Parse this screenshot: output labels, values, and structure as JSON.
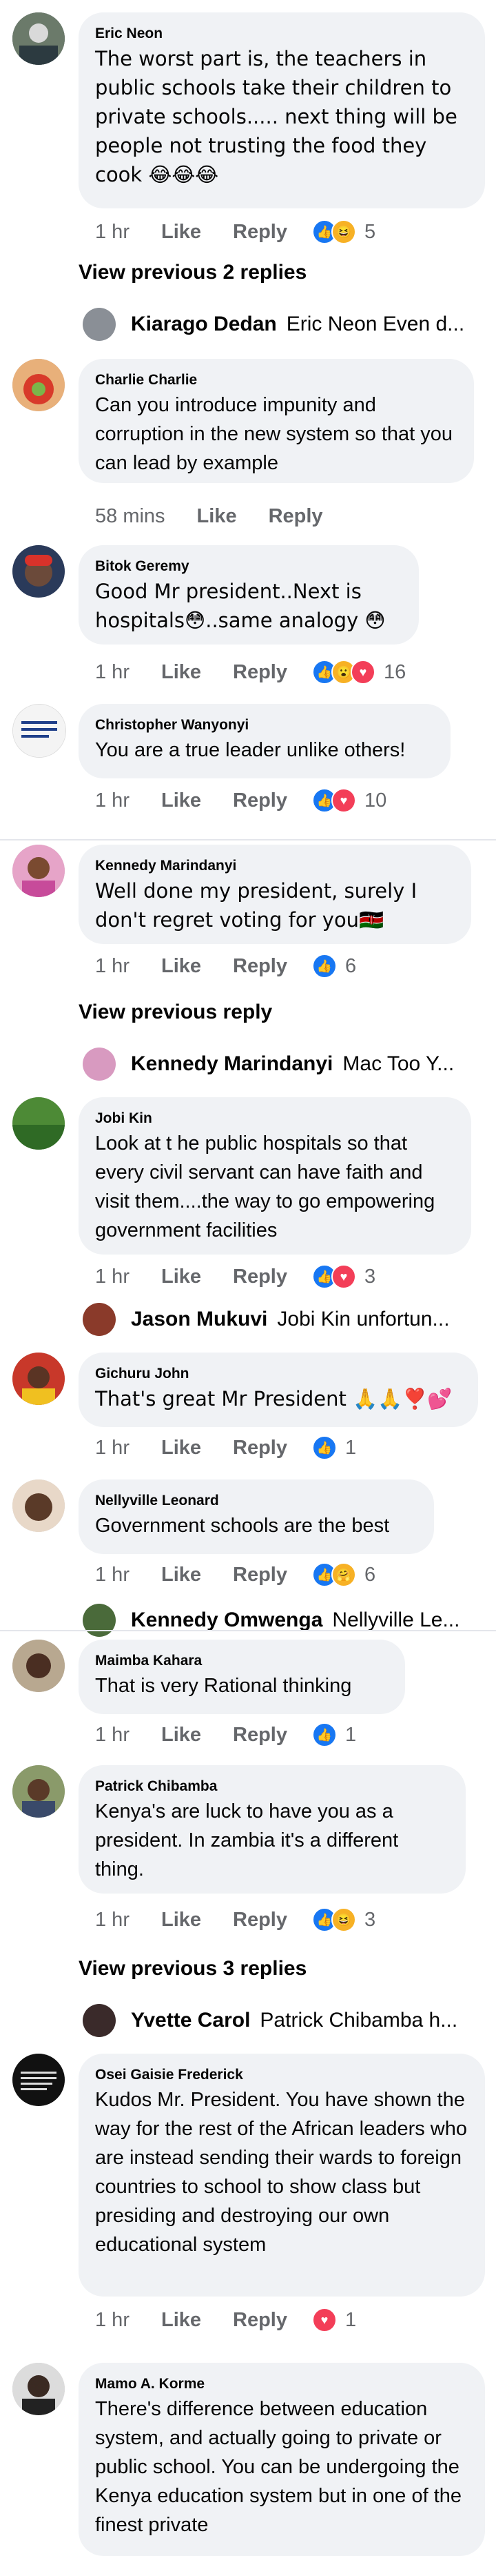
{
  "comments": [
    {
      "author": "Eric Neon",
      "text": "The worst part is, the teachers in public schools take their children to private schools..... next thing will be people not trusting the food they cook 😂😂😂",
      "time": "1 hr",
      "like": "Like",
      "reply": "Reply",
      "count": "5"
    },
    {
      "author": "Charlie Charlie",
      "text": "Can you introduce impunity and corruption in the new system so that you can lead by example",
      "time": "58 mins",
      "like": "Like",
      "reply": "Reply",
      "count": ""
    },
    {
      "author": "Bitok Geremy",
      "text": "Good Mr president..Next is hospitals😳..same analogy 😳",
      "time": "1 hr",
      "like": "Like",
      "reply": "Reply",
      "count": "16"
    },
    {
      "author": "Christopher Wanyonyi",
      "text": "You are a true leader unlike others!",
      "time": "1 hr",
      "like": "Like",
      "reply": "Reply",
      "count": "10"
    },
    {
      "author": "Kennedy Marindanyi",
      "text": "Well done my president, surely I don't regret voting for you🇰🇪",
      "time": "1 hr",
      "like": "Like",
      "reply": "Reply",
      "count": "6"
    },
    {
      "author": "Jobi Kin",
      "text": "Look at t he public hospitals so that every civil servant can have faith and visit them....the way to go empowering government facilities",
      "time": "1 hr",
      "like": "Like",
      "reply": "Reply",
      "count": "3"
    },
    {
      "author": "Gichuru John",
      "text": "That's great Mr President 🙏🙏❣️💕",
      "time": "1 hr",
      "like": "Like",
      "reply": "Reply",
      "count": "1"
    },
    {
      "author": "Nellyville Leonard",
      "text": "Government schools are the best",
      "time": "1 hr",
      "like": "Like",
      "reply": "Reply",
      "count": "6"
    },
    {
      "author": "Maimba Kahara",
      "text": "That is very Rational thinking",
      "time": "1 hr",
      "like": "Like",
      "reply": "Reply",
      "count": "1"
    },
    {
      "author": "Patrick Chibamba",
      "text": "Kenya's are luck to have you as a president. In zambia it's a different thing.",
      "time": "1 hr",
      "like": "Like",
      "reply": "Reply",
      "count": "3"
    },
    {
      "author": "Osei Gaisie Frederick",
      "text": "Kudos Mr. President.  You have shown the way for the rest of the African leaders who are instead sending their wards to foreign countries to school to show class but presiding and destroying our own educational system",
      "time": "1 hr",
      "like": "Like",
      "reply": "Reply",
      "count": "1"
    },
    {
      "author": "Mamo A. Korme",
      "text": "There's difference between education system, and actually going to private or public school. You can be undergoing the Kenya education system but in one of the finest private",
      "time": "",
      "like": "",
      "reply": "",
      "count": ""
    }
  ],
  "view_previous": {
    "two": "View previous 2 replies",
    "one": "View previous reply",
    "three": "View previous 3 replies"
  },
  "replies": [
    {
      "name": "Kiarago Dedan",
      "snippet": "Eric Neon Even d..."
    },
    {
      "name": "Kennedy Marindanyi",
      "snippet": "Mac Too Y..."
    },
    {
      "name": "Jason Mukuvi",
      "snippet": "Jobi Kin unfortun..."
    },
    {
      "name": "Kennedy Omwenga",
      "snippet": "Nellyville Le..."
    },
    {
      "name": "Yvette Carol",
      "snippet": "Patrick Chibamba h..."
    }
  ],
  "colors": {
    "bubble": "#f0f2f5",
    "like_blue": "#1877f2",
    "love_red": "#f33e58",
    "meta_gray": "#65676b"
  },
  "icons": [
    "like-reaction-icon",
    "love-reaction-icon",
    "haha-reaction-icon",
    "wow-reaction-icon",
    "care-reaction-icon"
  ]
}
